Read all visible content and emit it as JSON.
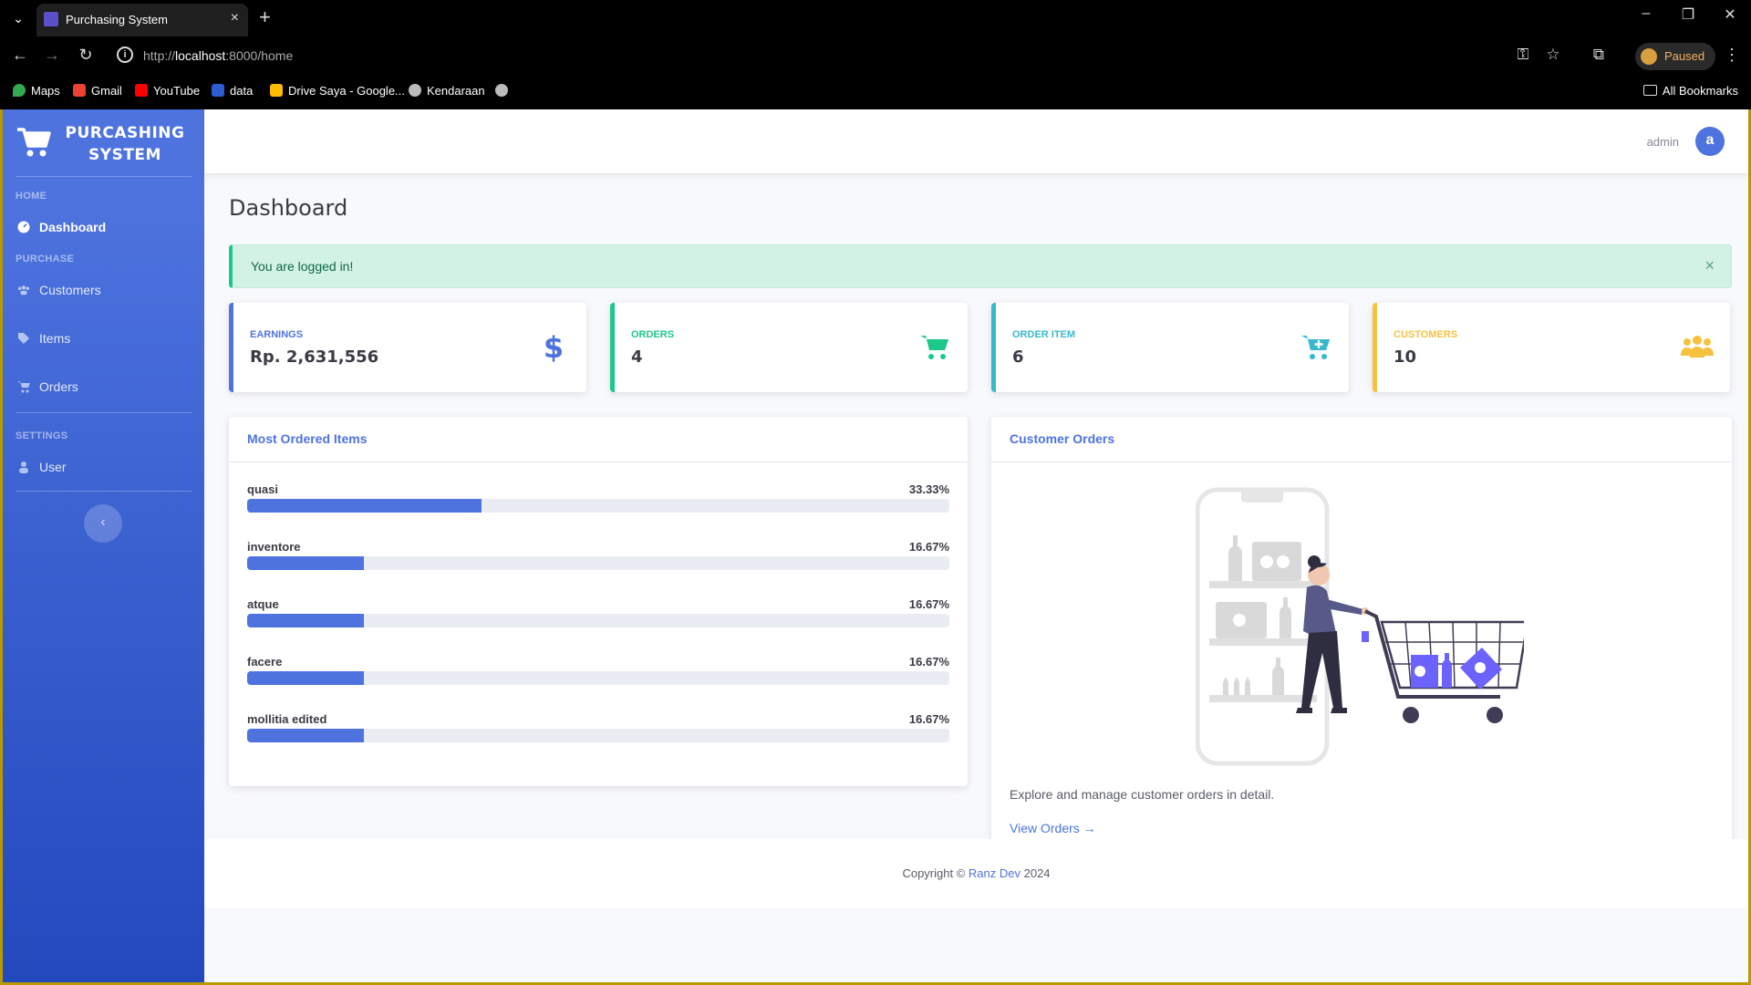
{
  "browser": {
    "tab_title": "Purchasing System",
    "url_scheme": "http://",
    "url_host": "localhost",
    "url_rest": ":8000/home",
    "profile_status": "Paused",
    "bookmarks": [
      "Maps",
      "Gmail",
      "YouTube",
      "data",
      "Drive Saya - Google...",
      "Kendaraan"
    ],
    "all_bookmarks": "All Bookmarks"
  },
  "sidebar": {
    "brand_line1": "PURCASHING",
    "brand_line2": "SYSTEM",
    "heading_home": "HOME",
    "heading_purchase": "PURCHASE",
    "heading_settings": "SETTINGS",
    "items": [
      {
        "label": "Dashboard",
        "icon": "dashboard-icon"
      },
      {
        "label": "Customers",
        "icon": "users-icon"
      },
      {
        "label": "Items",
        "icon": "tags-icon"
      },
      {
        "label": "Orders",
        "icon": "cart-icon"
      },
      {
        "label": "User",
        "icon": "user-icon"
      }
    ]
  },
  "topbar": {
    "user_name": "admin",
    "avatar_letter": "a"
  },
  "page": {
    "title": "Dashboard"
  },
  "alert": {
    "text": "You are logged in!",
    "close": "×"
  },
  "stats": [
    {
      "label": "EARNINGS",
      "value": "Rp. 2,631,556",
      "color": "#4e73df",
      "icon": "dollar-icon"
    },
    {
      "label": "ORDERS",
      "value": "4",
      "color": "#1cc88a",
      "icon": "cart-icon"
    },
    {
      "label": "ORDER ITEM",
      "value": "6",
      "color": "#36b9cc",
      "icon": "cart-plus-icon"
    },
    {
      "label": "CUSTOMERS",
      "value": "10",
      "color": "#f6c23e",
      "icon": "users-icon"
    }
  ],
  "most_ordered": {
    "title": "Most Ordered Items",
    "items": [
      {
        "name": "quasi",
        "pct_label": "33.33%",
        "pct": 33.33
      },
      {
        "name": "inventore",
        "pct_label": "16.67%",
        "pct": 16.67
      },
      {
        "name": "atque",
        "pct_label": "16.67%",
        "pct": 16.67
      },
      {
        "name": "facere",
        "pct_label": "16.67%",
        "pct": 16.67
      },
      {
        "name": "mollitia edited",
        "pct_label": "16.67%",
        "pct": 16.67
      }
    ]
  },
  "customer_orders": {
    "title": "Customer Orders",
    "description": "Explore and manage customer orders in detail.",
    "link": "View Orders →"
  },
  "footer": {
    "prefix": "Copyright ©",
    "brand": "Ranz Dev",
    "year": "2024"
  }
}
